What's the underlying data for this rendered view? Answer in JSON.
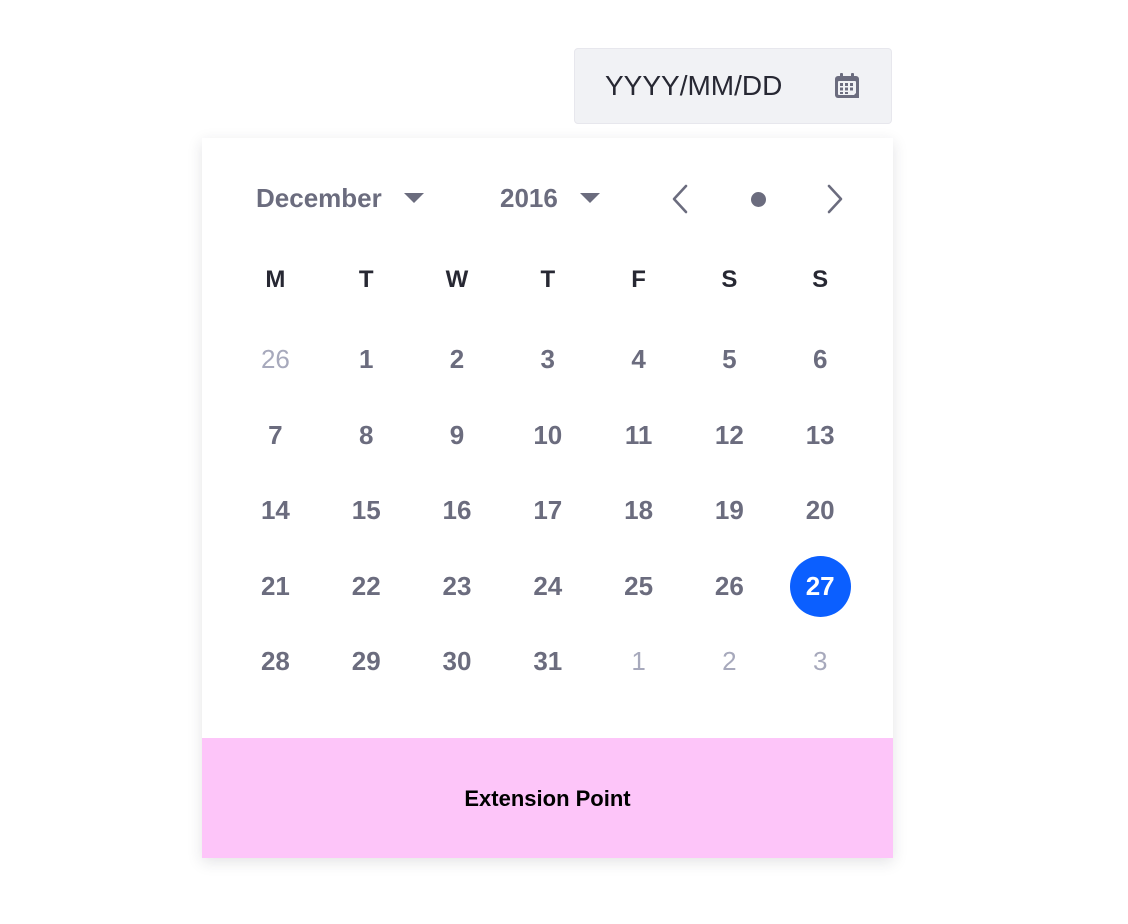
{
  "date_input": {
    "placeholder": "YYYY/MM/DD",
    "icon": "calendar-icon"
  },
  "header": {
    "month": "December",
    "year": "2016",
    "prev_icon": "chevron-left-icon",
    "next_icon": "chevron-right-icon",
    "today_icon": "dot-icon"
  },
  "weekdays": [
    "M",
    "T",
    "W",
    "T",
    "F",
    "S",
    "S"
  ],
  "days": [
    {
      "label": "26",
      "outside": true
    },
    {
      "label": "1"
    },
    {
      "label": "2"
    },
    {
      "label": "3"
    },
    {
      "label": "4"
    },
    {
      "label": "5"
    },
    {
      "label": "6"
    },
    {
      "label": "7"
    },
    {
      "label": "8"
    },
    {
      "label": "9"
    },
    {
      "label": "10"
    },
    {
      "label": "11"
    },
    {
      "label": "12"
    },
    {
      "label": "13"
    },
    {
      "label": "14"
    },
    {
      "label": "15"
    },
    {
      "label": "16"
    },
    {
      "label": "17"
    },
    {
      "label": "18"
    },
    {
      "label": "19"
    },
    {
      "label": "20"
    },
    {
      "label": "21"
    },
    {
      "label": "22"
    },
    {
      "label": "23"
    },
    {
      "label": "24"
    },
    {
      "label": "25"
    },
    {
      "label": "26"
    },
    {
      "label": "27",
      "selected": true
    },
    {
      "label": "28"
    },
    {
      "label": "29"
    },
    {
      "label": "30"
    },
    {
      "label": "31"
    },
    {
      "label": "1",
      "outside": true
    },
    {
      "label": "2",
      "outside": true
    },
    {
      "label": "3",
      "outside": true
    }
  ],
  "extension": {
    "label": "Extension Point"
  },
  "colors": {
    "accent": "#0b5fff",
    "extension_bg": "#fdc5f9",
    "text_secondary": "#6b6c7e",
    "text_muted": "#a7a9bc",
    "text_primary": "#272833",
    "input_bg": "#f1f2f5"
  }
}
